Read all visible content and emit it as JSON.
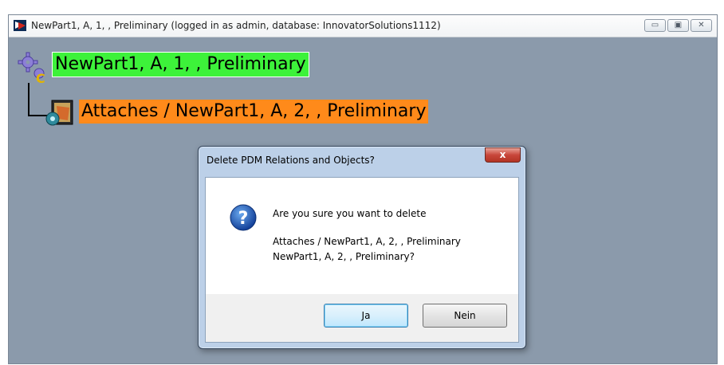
{
  "window": {
    "title": "NewPart1, A, 1, , Preliminary (logged in as admin, database: InnovatorSolutions1112)",
    "buttons": {
      "minimize": "▭",
      "maximize": "▣",
      "close": "✕"
    }
  },
  "tree": {
    "root_label": "NewPart1, A, 1, , Preliminary",
    "child_label": "Attaches / NewPart1, A, 2, , Preliminary",
    "colors": {
      "root_highlight": "#3df23a",
      "child_highlight": "#ff8a1a",
      "background": "#8b9aab"
    }
  },
  "dialog": {
    "title": "Delete PDM Relations and Objects?",
    "close_label": "x",
    "question": "Are you sure you want to delete",
    "line1": "Attaches / NewPart1, A, 2, , Preliminary",
    "line2": "NewPart1, A, 2, , Preliminary?",
    "yes_label": "Ja",
    "no_label": "Nein",
    "icon": "question-icon"
  }
}
